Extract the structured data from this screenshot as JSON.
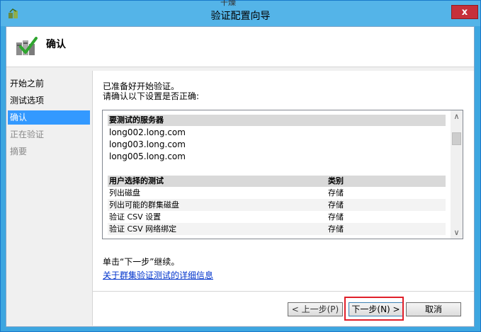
{
  "window": {
    "top_hint": "干燥",
    "title": "验证配置向导",
    "close_label": "x"
  },
  "header": {
    "title": "确认"
  },
  "nav": {
    "items": [
      {
        "label": "开始之前",
        "state": "normal"
      },
      {
        "label": "测试选项",
        "state": "normal"
      },
      {
        "label": "确认",
        "state": "active"
      },
      {
        "label": "正在验证",
        "state": "disabled"
      },
      {
        "label": "摘要",
        "state": "disabled"
      }
    ]
  },
  "main": {
    "intro_line1": "已准备好开始验证。",
    "intro_line2": "请确认以下设置是否正确:",
    "servers_header": "要测试的服务器",
    "servers": [
      "long002.long.com",
      "long003.long.com",
      "long005.long.com"
    ],
    "tests_header": {
      "name": "用户选择的测试",
      "category": "类别"
    },
    "tests": [
      {
        "name": "列出磁盘",
        "category": "存储"
      },
      {
        "name": "列出可能的群集磁盘",
        "category": "存储"
      },
      {
        "name": "验证 CSV 设置",
        "category": "存储"
      },
      {
        "name": "验证 CSV 网络绑定",
        "category": "存储"
      }
    ],
    "continue_text": "单击“下一步”继续。",
    "details_link": "关于群集验证测试的详细信息"
  },
  "buttons": {
    "prev": "< 上一步(P)",
    "next": "下一步(N) >",
    "cancel": "取消"
  },
  "colors": {
    "title_bar": "#54b4e8",
    "close": "#c6303a",
    "nav_active": "#3399ff",
    "highlight": "#e0202a"
  }
}
